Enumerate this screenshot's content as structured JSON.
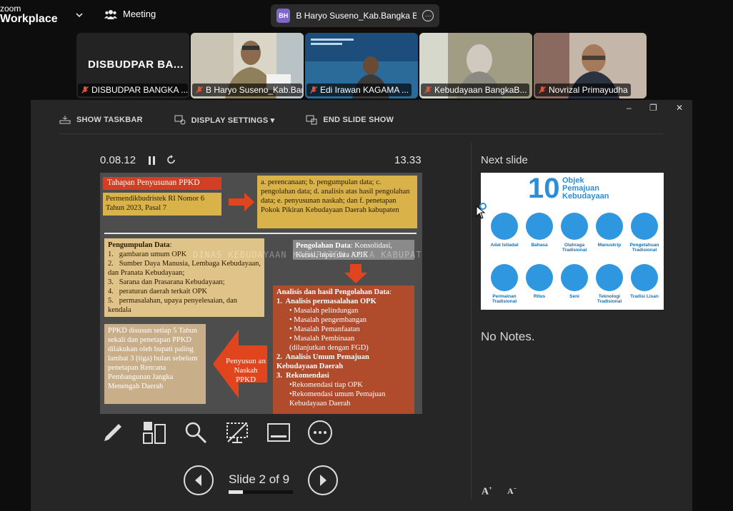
{
  "app": {
    "brand_line1": "zoom",
    "brand_line2": "Workplace",
    "meeting_label": "Meeting"
  },
  "speaker": {
    "initials": "BH",
    "name": "B Haryo Suseno_Kab.Bangka Bara"
  },
  "participants": [
    {
      "name": "DISBUDPAR BANGKA ...",
      "display": "DISBUDPAR BA...",
      "muted": true,
      "active": false
    },
    {
      "name": "B Haryo Suseno_Kab.Ban...",
      "muted": true,
      "active": true
    },
    {
      "name": "Edi Irawan KAGAMA ...",
      "muted": true,
      "active": false
    },
    {
      "name": "Kebudayaan BangkaB...",
      "muted": true,
      "active": false
    },
    {
      "name": "Novrizal Primayudha",
      "muted": true,
      "active": false
    }
  ],
  "presenter": {
    "toolbar": {
      "show_taskbar": "SHOW TASKBAR",
      "display_settings": "DISPLAY SETTINGS ▾",
      "end_slide_show": "END SLIDE SHOW"
    },
    "timer": "0.08.12",
    "clock": "13.33",
    "slide_counter": "Slide 2 of 9",
    "progress_fraction": 0.2222,
    "next_slide_label": "Next slide",
    "notes": "No Notes."
  },
  "slide": {
    "title": "Tahapan Penyusunan PPKD",
    "regulation": "Permendikbudristek RI Nomor 6 Tahun 2023, Pasal 7",
    "steps": "a. perencanaan; b. pengumpulan data; c. pengolahan data; d. analisis atas hasil pengolahan data; e. penyusunan naskah; dan f. penetapan Pokok Pikiran Kebudayaan Daerah kabupaten",
    "pengumpulan_title": "Pengumpulan Data",
    "pengumpulan_items": [
      "1.   gambaran umum OPK",
      "2.   Sumber Daya Manusia, Lembaga Kebudayaan, dan Pranata Kebudayaan;",
      "3.   Sarana dan Prasarana Kebudayaan;",
      "4.   peraturan daerah terkait OPK",
      "5.   permasalahan, upaya penyelesaian, dan kendala"
    ],
    "pengolahan_title": "Pengolahan Data",
    "pengolahan_text": ": Konsolidasi, Kurasi, input data APIK",
    "watermark": "DINAS KEBUDAYAAN KABUPATEN KOTA KABUPATEN BAN",
    "analisis_title": "Analisis dan hasil Pengolahan Data",
    "analisis_items": [
      "1.  Analisis permasalahan OPK",
      "• Masalah pelindungan",
      "• Masalah pengembangan",
      "• Masalah Pemanfaatan",
      "• Masalah Pembinaan",
      "(dilanjutkan dengan FGD)",
      "2.  Analisis Umum Pemajuan Kebudayaan Daerah",
      "3.  Rekomendasi",
      "•Rekomendasi tiap OPK",
      "•Rekomendasi umum Pemajuan Kebudayaan Daerah"
    ],
    "ppkd_text": "PPKD disusun setiap 5 Tahun sekali dan penetapan PPKD dilakukan oleh bupati paling lambat 3 (tiga) bulan sebelum penetapan Rencana Pembangunan Jangka Menengah Daerah",
    "penyusunan": "Penyusun an Naskah PPKD"
  },
  "next_slide": {
    "number": "10",
    "title_lines": [
      "Objek",
      "Pemajuan",
      "Kebudayaan"
    ],
    "items": [
      "Adat Istiadat",
      "Bahasa",
      "Olahraga Tradisional",
      "Manuskrip",
      "Pengetahuan Tradisional",
      "Permainan Tradisional",
      "Ritus",
      "Seni",
      "Teknologi Tradisional",
      "Tradisi Lisan"
    ]
  },
  "colors": {
    "active_tile": "#3bc46a",
    "muted_red": "#e0533d",
    "bh_badge": "#7f66c8",
    "next_slide_blue": "#2b8ed8"
  }
}
